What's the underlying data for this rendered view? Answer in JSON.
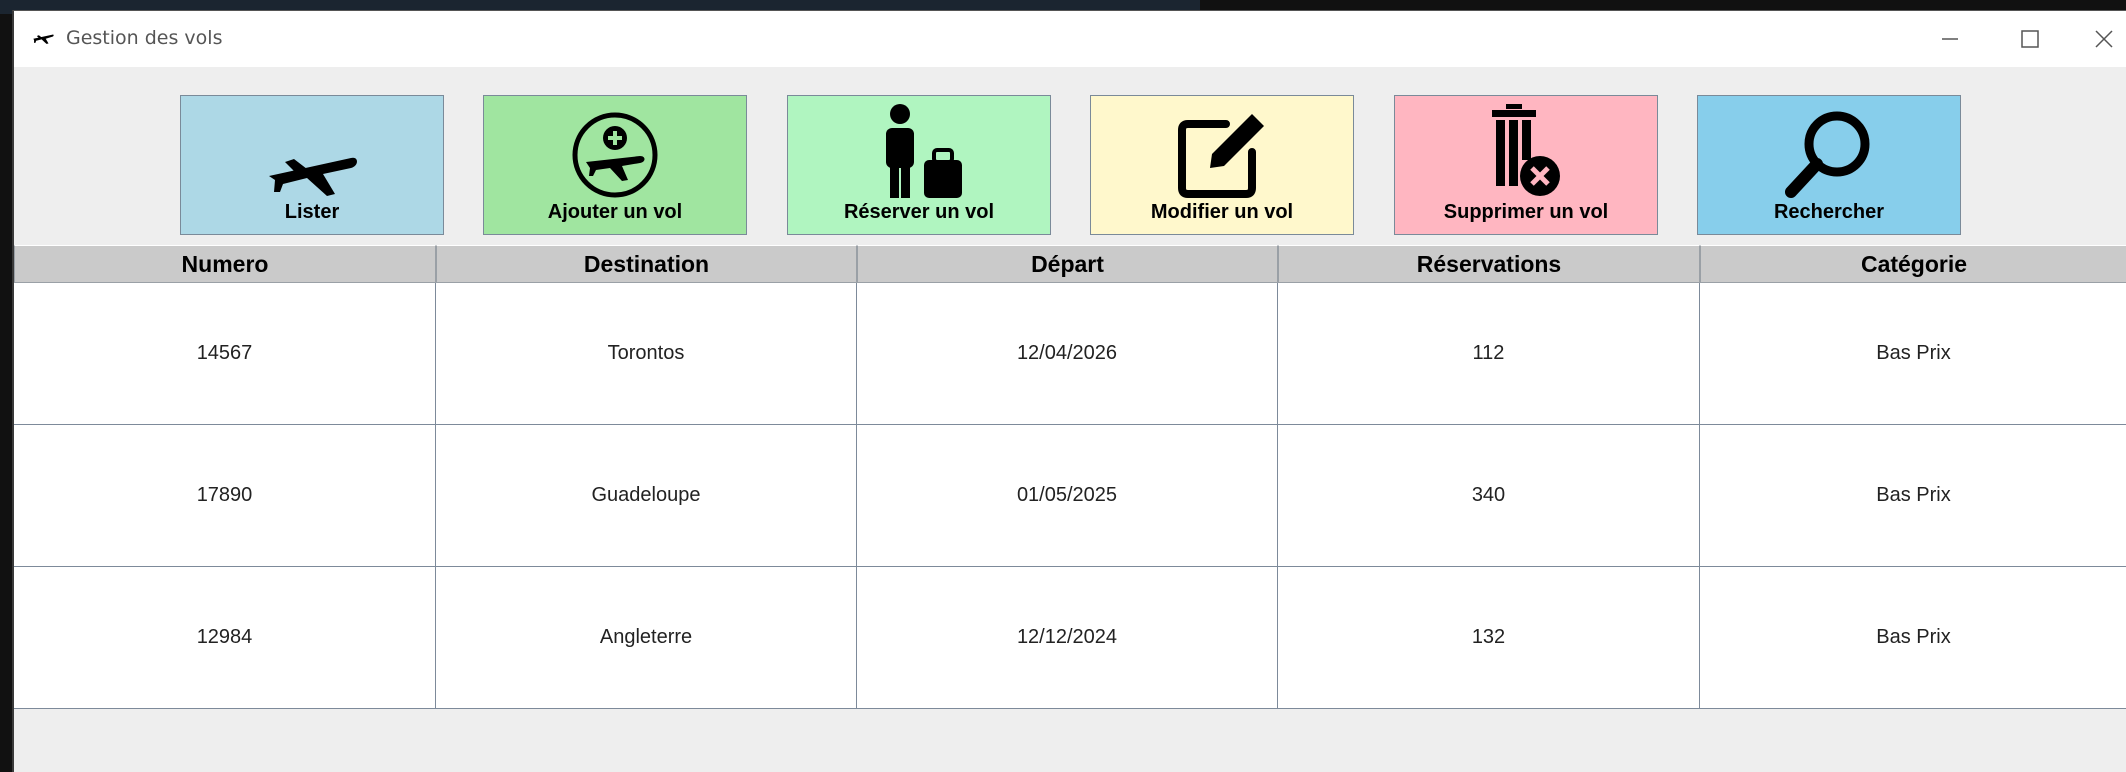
{
  "window": {
    "title": "Gestion des vols"
  },
  "toolbar": [
    {
      "label": "Lister",
      "icon": "airplane-icon",
      "color": "#add8e6"
    },
    {
      "label": "Ajouter un vol",
      "icon": "add-flight-icon",
      "color": "#a0e5a0"
    },
    {
      "label": "Réserver un vol",
      "icon": "traveler-luggage-icon",
      "color": "#b0f5c0"
    },
    {
      "label": "Modifier un vol",
      "icon": "edit-icon",
      "color": "#fff8cc"
    },
    {
      "label": "Supprimer un vol",
      "icon": "trash-delete-icon",
      "color": "#ffb6c1"
    },
    {
      "label": "Rechercher",
      "icon": "search-icon",
      "color": "#87ceeb"
    }
  ],
  "table": {
    "columns": [
      "Numero",
      "Destination",
      "Départ",
      "Réservations",
      "Catégorie"
    ],
    "rows": [
      [
        "14567",
        "Torontos",
        "12/04/2026",
        "112",
        "Bas Prix"
      ],
      [
        "17890",
        "Guadeloupe",
        "01/05/2025",
        "340",
        "Bas Prix"
      ],
      [
        "12984",
        "Angleterre",
        "12/12/2024",
        "132",
        "Bas Prix"
      ]
    ]
  }
}
